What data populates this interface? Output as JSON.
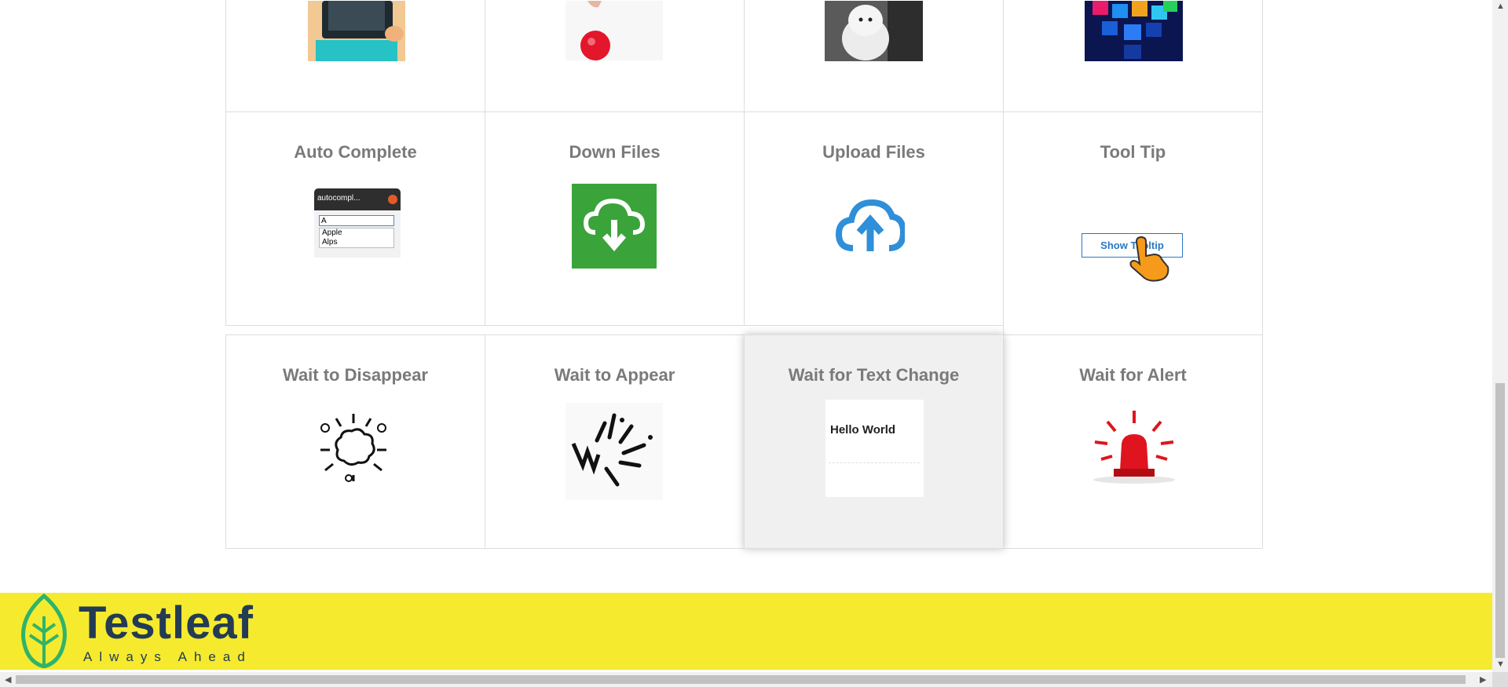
{
  "tiles_top_row": [
    "",
    "",
    "",
    ""
  ],
  "tiles_row2": [
    {
      "title": "Auto Complete",
      "thumb": "autocomplete-window-icon"
    },
    {
      "title": "Down Files",
      "thumb": "download-cloud-icon"
    },
    {
      "title": "Upload Files",
      "thumb": "upload-cloud-icon"
    },
    {
      "title": "Tool Tip",
      "thumb": "tooltip-button"
    }
  ],
  "tiles_row3": [
    {
      "title": "Wait to Disappear",
      "thumb": "burst-icon"
    },
    {
      "title": "Wait to Appear",
      "thumb": "sparks-icon"
    },
    {
      "title": "Wait for Text Change",
      "thumb": "hello-world-image"
    },
    {
      "title": "Wait for Alert",
      "thumb": "siren-icon"
    }
  ],
  "autocomplete": {
    "window_title": "autocompl...",
    "input": "A",
    "options": [
      "Apple",
      "Alps"
    ]
  },
  "tooltip_button": "Show Tooltip",
  "hello_text": "Hello World",
  "footer": {
    "brand": "Testleaf",
    "tagline": "Always Ahead",
    "bg_color": "#f5ea2e",
    "text_color": "#233b54"
  },
  "colors": {
    "green_tile": "#3aa43a",
    "cloud_blue": "#2f8fd8",
    "title_gray": "#7a7a7a"
  }
}
